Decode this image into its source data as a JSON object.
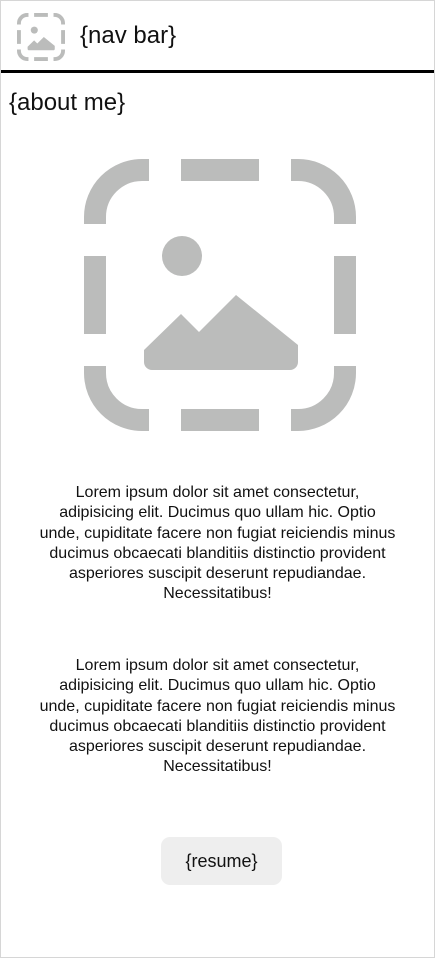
{
  "navbar": {
    "logo_icon": "image-placeholder-icon",
    "title": "{nav bar}"
  },
  "about": {
    "title": "{about me}",
    "image_icon": "image-placeholder-icon",
    "paragraphs": [
      "Lorem ipsum dolor sit amet consectetur, adipisicing elit. Ducimus quo ullam hic. Optio unde, cupiditate facere non fugiat reiciendis minus ducimus obcaecati blanditiis distinctio provident asperiores suscipit deserunt repudiandae. Necessitatibus!",
      "Lorem ipsum dolor sit amet consectetur, adipisicing elit. Ducimus quo ullam hic. Optio unde, cupiditate facere non fugiat reiciendis minus ducimus obcaecati blanditiis distinctio provident asperiores suscipit deserunt repudiandae. Necessitatibus!"
    ]
  },
  "resume_button": {
    "label": "{resume}"
  },
  "colors": {
    "placeholder_icon": "#bbbcbb",
    "button_background": "#eeeeee",
    "divider": "#000000",
    "frame_border": "#d6d6d6",
    "text": "#111111"
  }
}
